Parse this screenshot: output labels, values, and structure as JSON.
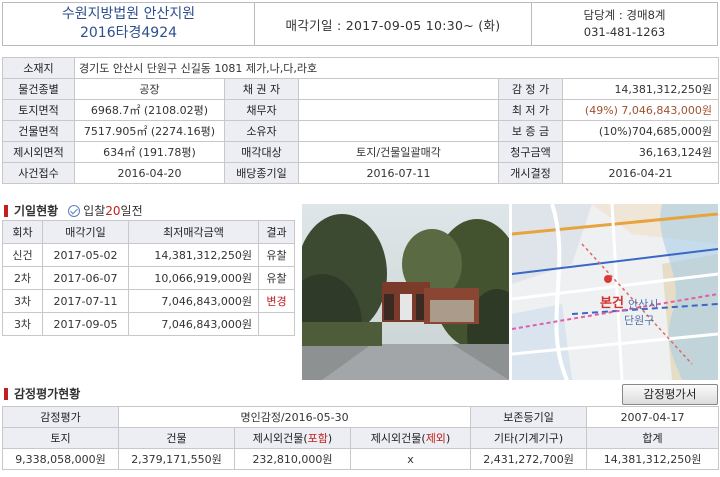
{
  "header": {
    "court": "수원지방법원 안산지원",
    "case_no": "2016타경4924",
    "sale_date": "매각기일 : 2017-09-05   10:30~ (화)",
    "dept": "담당계 : 경매8계",
    "phone": "031-481-1263"
  },
  "info": {
    "address_label": "소재지",
    "address": "경기도 안산시 단원구 신길동 1081 제가,나,다,라호",
    "rows": [
      {
        "l1": "물건종별",
        "v1": "공장",
        "l2": "채 권 자",
        "v2": "",
        "l3": "감 정 가",
        "v3": "14,381,312,250원"
      },
      {
        "l1": "토지면적",
        "v1": "6968.7㎡ (2108.02평)",
        "l2": "채무자",
        "v2": "",
        "l3": "최 저 가",
        "v3": "(49%) 7,046,843,000원"
      },
      {
        "l1": "건물면적",
        "v1": "7517.905㎡ (2274.16평)",
        "l2": "소유자",
        "v2": "",
        "l3": "보 증 금",
        "v3": "(10%)704,685,000원"
      },
      {
        "l1": "제시외면적",
        "v1": "634㎡ (191.78평)",
        "l2": "매각대상",
        "v2": "토지/건물일괄매각",
        "l3": "청구금액",
        "v3": "36,163,124원"
      },
      {
        "l1": "사건접수",
        "v1": "2016-04-20",
        "l2": "배당종기일",
        "v2": "2016-07-11",
        "l3": "개시결정",
        "v3": "2016-04-21"
      }
    ]
  },
  "history": {
    "title": "기일현황",
    "sub_prefix": "입찰",
    "sub_days": "20",
    "sub_suffix": "일전",
    "headers": [
      "회차",
      "매각기일",
      "최저매각금액",
      "결과"
    ],
    "rows": [
      {
        "round": "신건",
        "date": "2017-05-02",
        "price": "14,381,312,250원",
        "result": "유찰"
      },
      {
        "round": "2차",
        "date": "2017-06-07",
        "price": "10,066,919,000원",
        "result": "유찰"
      },
      {
        "round": "3차",
        "date": "2017-07-11",
        "price": "7,046,843,000원",
        "result": "변경"
      },
      {
        "round": "3차",
        "date": "2017-09-05",
        "price": "7,046,843,000원",
        "result": ""
      }
    ]
  },
  "map": {
    "label_main": "본건",
    "label_district1": "안산시",
    "label_district2": "단원구"
  },
  "appraisal": {
    "title": "감정평가현황",
    "button": "감정평가서",
    "row1": {
      "l1": "감정평가",
      "v1": "명인감정/2016-05-30",
      "l2": "보존등기일",
      "v2": "2007-04-17"
    },
    "headers": [
      "토지",
      "건물",
      "제시외건물(",
      "포함",
      ")",
      "제시외건물(",
      "제외",
      ")",
      "기타(기계기구)",
      "합계"
    ],
    "values": [
      "9,338,058,000원",
      "2,379,171,550원",
      "232,810,000원",
      "x",
      "2,431,272,700원",
      "14,381,312,250원"
    ]
  }
}
